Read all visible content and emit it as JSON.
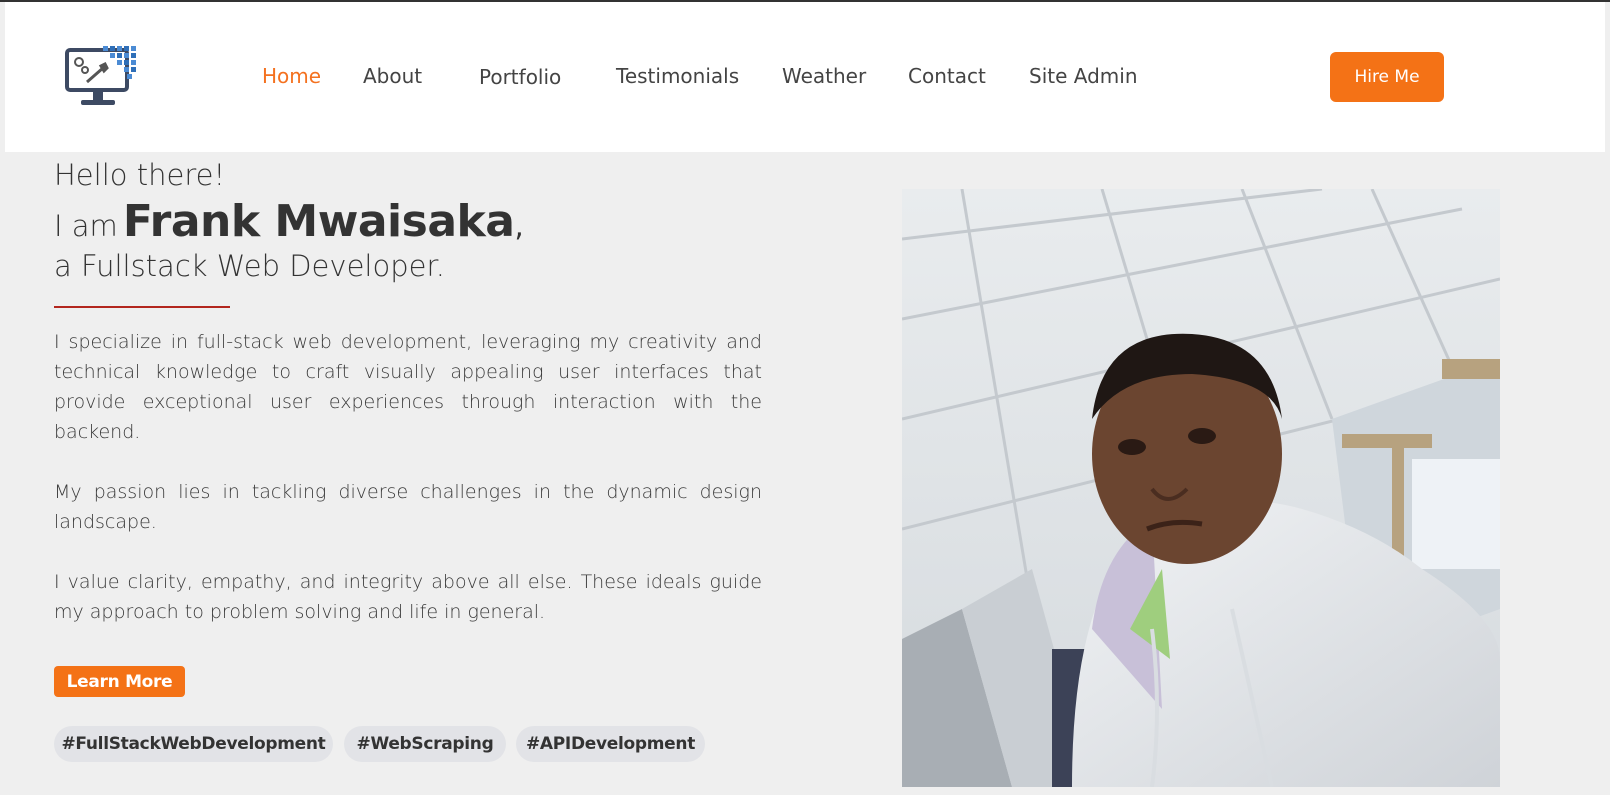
{
  "nav": {
    "logo_icon": "computer-repair-icon",
    "items": [
      {
        "label": "Home",
        "active": true
      },
      {
        "label": "About"
      },
      {
        "label": "Portfolio"
      },
      {
        "label": "Testimonials"
      },
      {
        "label": "Weather"
      },
      {
        "label": "Contact"
      },
      {
        "label": "Site Admin"
      }
    ],
    "hire_label": "Hire Me"
  },
  "hero": {
    "greeting": "Hello there!",
    "iam_prefix": "I am",
    "name": "Frank Mwaisaka",
    "comma": ",",
    "role": "a Fullstack Web Developer.",
    "paragraphs": [
      "I specialize in full-stack web development, leveraging my creativity and technical knowledge to craft visually appealing user interfaces that provide exceptional user experiences through interaction with the backend.",
      "My passion lies in tackling diverse challenges in the dynamic design landscape.",
      "I value clarity, empathy, and integrity above all else. These ideals guide my approach to problem solving and life in general."
    ],
    "learn_more_label": "Learn More",
    "tags": [
      "#FullStackWebDevelopment",
      "#WebScraping",
      "#APIDevelopment"
    ]
  },
  "colors": {
    "accent": "#f47216",
    "divider": "#b3261e",
    "background": "#efefef"
  }
}
